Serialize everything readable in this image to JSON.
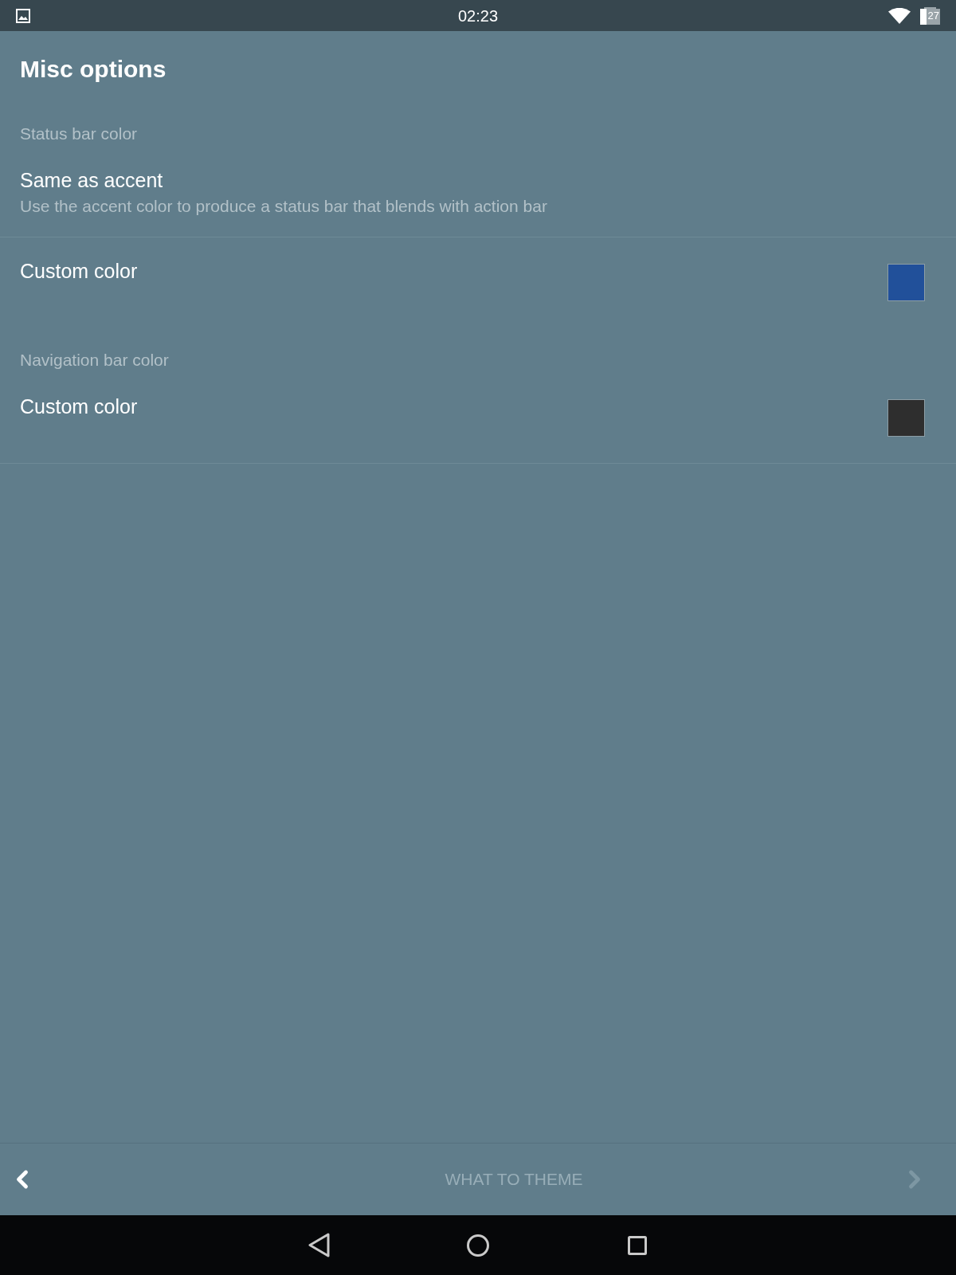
{
  "status_bar": {
    "time": "02:23",
    "battery_text": "27"
  },
  "title": "Misc options",
  "sections": [
    {
      "header": "Status bar color",
      "items": [
        {
          "kind": "text",
          "title": "Same as accent",
          "summary": "Use the accent color to produce a status bar that blends with action bar"
        },
        {
          "kind": "color",
          "title": "Custom color",
          "color": "#21509a"
        }
      ]
    },
    {
      "header": "Navigation bar color",
      "items": [
        {
          "kind": "color",
          "title": "Custom color",
          "color": "#2e2e2e"
        }
      ]
    }
  ],
  "bottom_bar": {
    "back_button": {
      "disabled": false
    },
    "label": "WHAT TO THEME",
    "next_button": {
      "disabled": true
    }
  }
}
